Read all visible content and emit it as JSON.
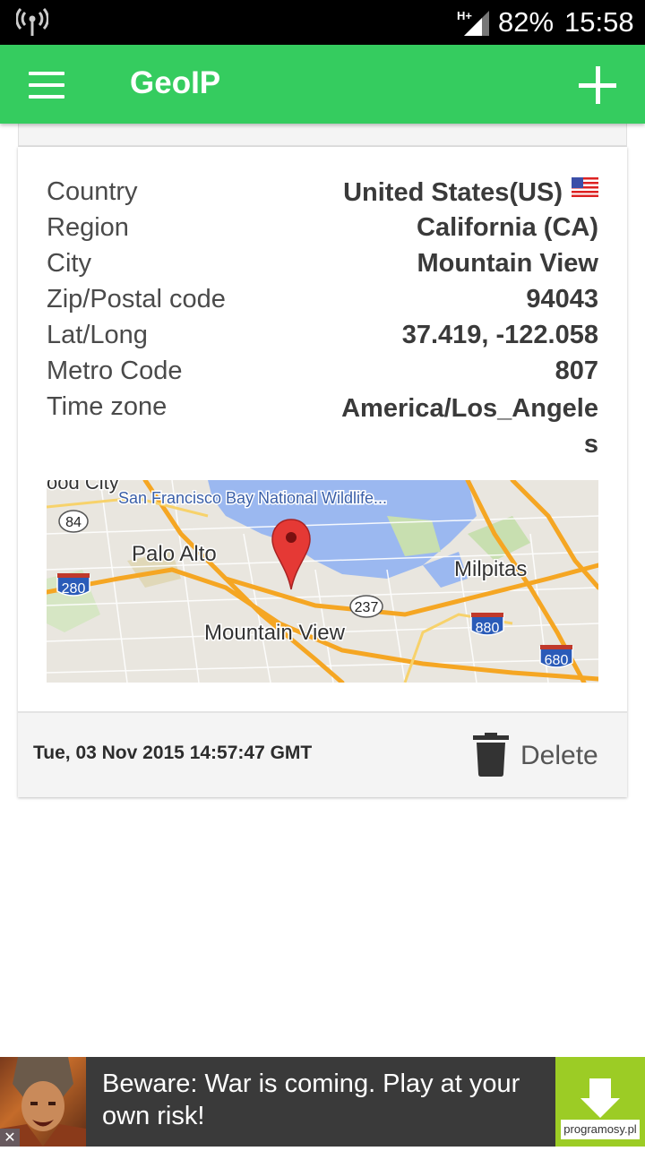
{
  "status_bar": {
    "network": "H+",
    "battery": "82%",
    "time": "15:58"
  },
  "app_bar": {
    "title": "GeoIP",
    "menu_icon": "hamburger-menu-icon",
    "add_icon": "plus-icon"
  },
  "record": {
    "rows": [
      {
        "label": "Country",
        "value": "United States(US)"
      },
      {
        "label": "Region",
        "value": "California (CA)"
      },
      {
        "label": "City",
        "value": "Mountain View"
      },
      {
        "label": "Zip/Postal code",
        "value": "94043"
      },
      {
        "label": "Lat/Long",
        "value": "37.419, -122.058"
      },
      {
        "label": "Metro Code",
        "value": "807"
      },
      {
        "label": "Time zone",
        "value": "America/Los_Angeles"
      }
    ],
    "country_flag": "us-flag-icon",
    "map": {
      "labels": [
        "San Francisco Bay National Wildlife...",
        "Palo Alto",
        "Milpitas",
        "Mountain View",
        "ood City"
      ],
      "highways": [
        "84",
        "280",
        "237",
        "880",
        "680"
      ]
    },
    "timestamp": "Tue, 03 Nov 2015 14:57:47 GMT",
    "delete_label": "Delete"
  },
  "ad": {
    "text": "Beware: War is coming. Play at your own risk!",
    "watermark": "programosy.pl",
    "close_glyph": "✕"
  },
  "colors": {
    "app_bar": "#35cc5f",
    "ad_download": "#9ccc25",
    "map_pin": "#e53935"
  }
}
